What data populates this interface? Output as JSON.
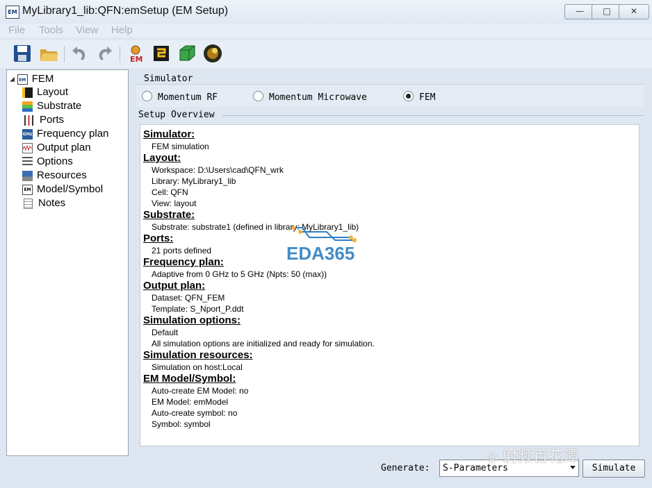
{
  "window": {
    "icon_text": "EM",
    "title": "MyLibrary1_lib:QFN:emSetup (EM Setup)",
    "controls": {
      "minimize": "—",
      "maximize": "□",
      "close": "✕"
    }
  },
  "menu": [
    "File",
    "Tools",
    "View",
    "Help"
  ],
  "toolbar": {
    "buttons": [
      "save-icon",
      "open-icon",
      "undo-icon",
      "redo-icon",
      "em-icon",
      "layout-icon",
      "3d-view-icon",
      "momentum-viewer-icon"
    ],
    "em_label": "EM"
  },
  "tree": {
    "root": "FEM",
    "items": [
      "Layout",
      "Substrate",
      "Ports",
      "Frequency plan",
      "Output plan",
      "Options",
      "Resources",
      "Model/Symbol",
      "Notes"
    ]
  },
  "simulator": {
    "label": "Simulator",
    "options": [
      "Momentum RF",
      "Momentum Microwave",
      "FEM"
    ],
    "selected": "FEM"
  },
  "overview": {
    "label": "Setup Overview",
    "simulator_h": "Simulator:",
    "simulator_line": "FEM simulation",
    "layout_h": "Layout:",
    "layout_lines": [
      "Workspace: D:\\Users\\cad\\QFN_wrk",
      "Library: MyLibrary1_lib",
      "Cell: QFN",
      "View: layout"
    ],
    "substrate_h": "Substrate:",
    "substrate_line": "Substrate: substrate1 (defined in library: MyLibrary1_lib)",
    "ports_h": "Ports:",
    "ports_line": "21 ports defined",
    "freq_h": "Frequency plan:",
    "freq_line": "Adaptive from 0 GHz to 5 GHz (Npts: 50 (max))",
    "output_h": "Output plan:",
    "output_lines": [
      "Dataset: QFN_FEM",
      "Template: S_Nport_P.ddt"
    ],
    "options_h": "Simulation options:",
    "options_lines": [
      "Default",
      "All simulation options are initialized and ready for simulation."
    ],
    "resources_h": "Simulation resources:",
    "resources_line": "Simulation on host:Local",
    "model_h": "EM Model/Symbol:",
    "model_lines": [
      "Auto-create EM Model: no",
      "EM Model: emModel",
      "Auto-create symbol: no",
      "Symbol: symbol"
    ]
  },
  "watermark": {
    "text": "EDA365",
    "wechat": "射频百花潭"
  },
  "footer": {
    "generate_label": "Generate:",
    "generate_value": "S-Parameters",
    "simulate_button": "Simulate"
  }
}
